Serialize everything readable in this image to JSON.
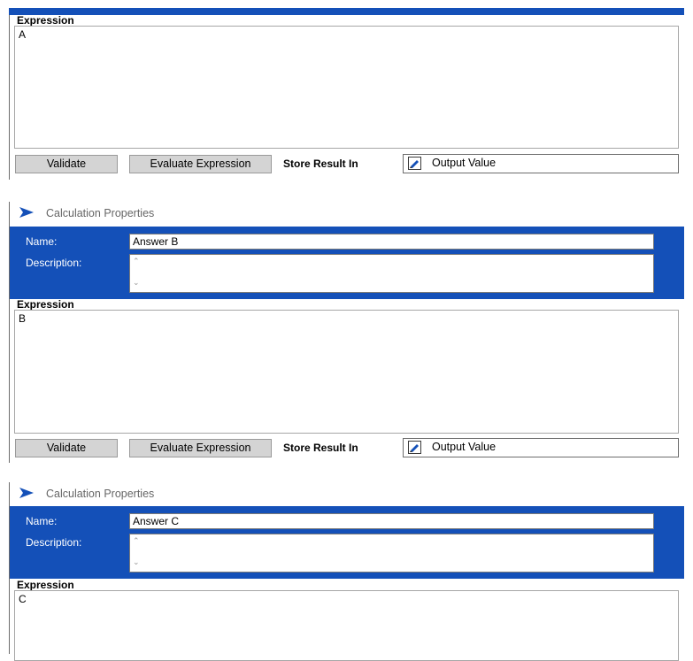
{
  "sections": [
    {
      "expression_label": "Expression",
      "expression_value": "A",
      "validate_label": "Validate",
      "evaluate_label": "Evaluate Expression",
      "store_result_label": "Store Result In",
      "output_value": "Output Value"
    },
    {
      "header_title": "Calculation Properties",
      "name_label": "Name:",
      "name_value": "Answer B",
      "description_label": "Description:",
      "description_value": "",
      "expression_label": "Expression",
      "expression_value": "B",
      "validate_label": "Validate",
      "evaluate_label": "Evaluate Expression",
      "store_result_label": "Store Result In",
      "output_value": "Output Value"
    },
    {
      "header_title": "Calculation Properties",
      "name_label": "Name:",
      "name_value": "Answer C",
      "description_label": "Description:",
      "description_value": "",
      "expression_label": "Expression",
      "expression_value": "C"
    }
  ],
  "icons": {
    "calc_icon": "calculation-arrow-icon",
    "output_icon": "output-value-icon",
    "scroll_up": "chevron-up-icon",
    "scroll_down": "chevron-down-icon"
  },
  "colors": {
    "panel_blue": "#1450b8",
    "button_gray": "#d4d4d4"
  }
}
